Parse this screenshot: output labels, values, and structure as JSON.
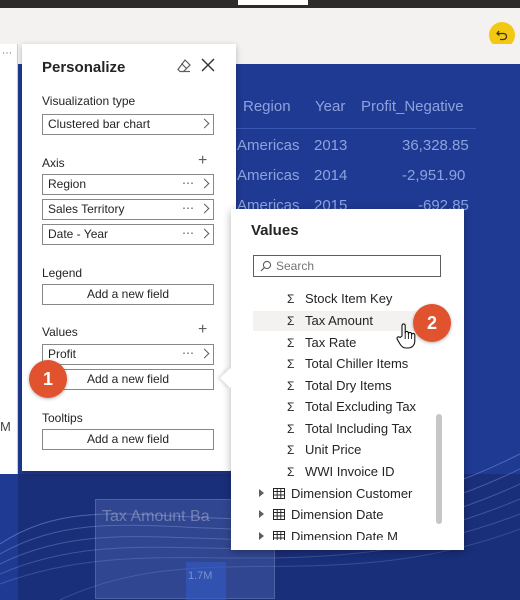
{
  "report": {
    "table_headers": [
      "Region",
      "Year",
      "Profit_Negative"
    ],
    "table_rows": [
      [
        "Americas",
        "2013",
        "36,328.85"
      ],
      [
        "Americas",
        "2014",
        "-2,951.90"
      ],
      [
        "Americas",
        "2015",
        "-692.85"
      ]
    ],
    "bg_card_title": "Tax Amount Ba",
    "bg_card_value": "1.7M",
    "left_strip_text": "M"
  },
  "personalize": {
    "title": "Personalize",
    "viz_label": "Visualization type",
    "viz_value": "Clustered bar chart",
    "axis_label": "Axis",
    "axis_fields": [
      "Region",
      "Sales Territory",
      "Date - Year"
    ],
    "legend_label": "Legend",
    "legend_add": "Add a new field",
    "values_label": "Values",
    "values_field": "Profit",
    "values_add": "Add a new field",
    "tooltips_label": "Tooltips",
    "tooltips_add": "Add a new field"
  },
  "values_flyout": {
    "title": "Values",
    "search_placeholder": "Search",
    "measures": [
      "Stock Item Key",
      "Tax Amount",
      "Tax Rate",
      "Total Chiller Items",
      "Total Dry Items",
      "Total Excluding Tax",
      "Total Including Tax",
      "Unit Price",
      "WWI Invoice ID"
    ],
    "sigma": "Σ",
    "tables": [
      "Dimension Customer",
      "Dimension Date",
      "Dimension Date M"
    ]
  },
  "callouts": [
    "1",
    "2"
  ],
  "colors": {
    "canvas": "#1f3a93",
    "callout": "#e0532e",
    "undo": "#f2c811"
  }
}
